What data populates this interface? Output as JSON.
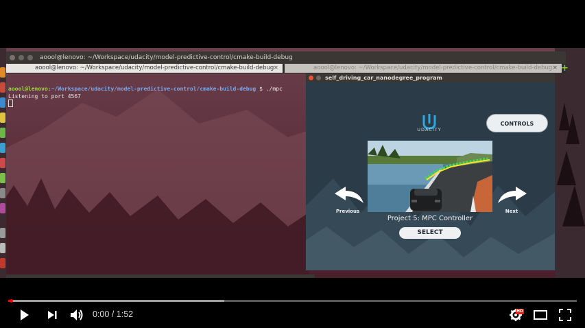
{
  "terminal": {
    "window_title": "aoool@lenovo: ~/Workspace/udacity/model-predictive-control/cmake-build-debug",
    "tabs": [
      {
        "label": "aoool@lenovo: ~/Workspace/udacity/model-predictive-control/cmake-build-debug",
        "close": "×"
      },
      {
        "label": "aoool@lenovo: ~/Workspace/udacity/model-predictive-control/cmake-build-debug",
        "close": "×"
      }
    ],
    "new_tab": "+",
    "prompt_user": "aoool@lenovo",
    "prompt_sep": ":",
    "prompt_path": "~/Workspace/udacity/model-predictive-control/cmake-build-debug",
    "command": "$ ./mpc",
    "output": "Listening to port 4567"
  },
  "simulator": {
    "window_title": "self_driving_car_nanodegree_program",
    "logo_text": "UDACITY",
    "controls_label": "CONTROLS",
    "previous_label": "Previous",
    "next_label": "Next",
    "project_title": "Project 5: MPC Controller",
    "select_label": "SELECT"
  },
  "player": {
    "time_current": "0:00",
    "time_separator": " / ",
    "time_total": "1:52",
    "hd_badge": "HD",
    "progress_played": 0.005,
    "progress_buffered": 0.38,
    "colors": {
      "accent": "#ff0000"
    }
  },
  "icons": [
    "play-icon",
    "next-icon",
    "volume-icon",
    "settings-icon",
    "theater-icon",
    "fullscreen-icon"
  ]
}
